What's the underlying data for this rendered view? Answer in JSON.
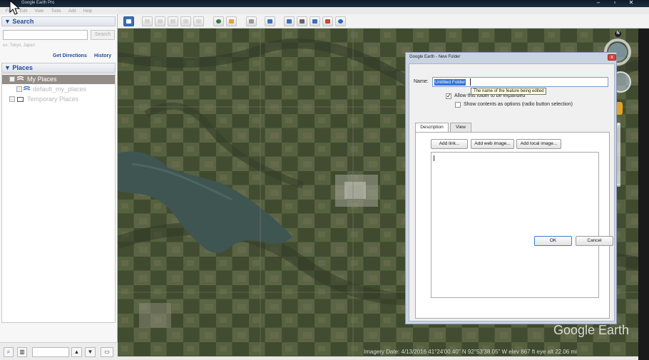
{
  "window": {
    "title": "Google Earth Pro",
    "buttons": [
      "–",
      "▫",
      "✕"
    ]
  },
  "menu": [
    "File",
    "Edit",
    "View",
    "Tools",
    "Add",
    "Help"
  ],
  "search": {
    "header": "▼ Search",
    "placeholder": "",
    "button": "Search",
    "hint": "ex: Tokyo, Japan",
    "get_directions": "Get Directions",
    "history": "History"
  },
  "places": {
    "header": "▼ Places",
    "items": [
      {
        "label": "My Places",
        "selected": true
      },
      {
        "label": "default_my_places",
        "selected": false
      },
      {
        "label": "Temporary Places",
        "selected": false
      }
    ]
  },
  "map": {
    "status": "Imagery Date: 4/13/2016     41°24'00.40\" N    92°53'38.05\" W   elev   867 ft      eye alt  22.06 mi",
    "logo": "Google Earth",
    "north": "N",
    "zoom_in": "+",
    "zoom_out": "−"
  },
  "dialog": {
    "title": "Google Earth - New Folder",
    "close": "x",
    "name_label": "Name:",
    "name_value": "Untitled Folder",
    "tooltip": "The name of the feature being edited",
    "allow_expand": "Allow this folder to be expanded",
    "show_contents": "Show contents as options (radio button selection)",
    "tabs": [
      "Description",
      "View"
    ],
    "add_link": "Add link...",
    "add_web_image": "Add web image...",
    "add_local_image": "Add local image...",
    "ok": "OK",
    "cancel": "Cancel"
  },
  "colors": {
    "accent": "#1f4e9b",
    "selection": "#3173d3",
    "selected_row": "#938c86",
    "dialog_frame": "#c9d3e3"
  }
}
